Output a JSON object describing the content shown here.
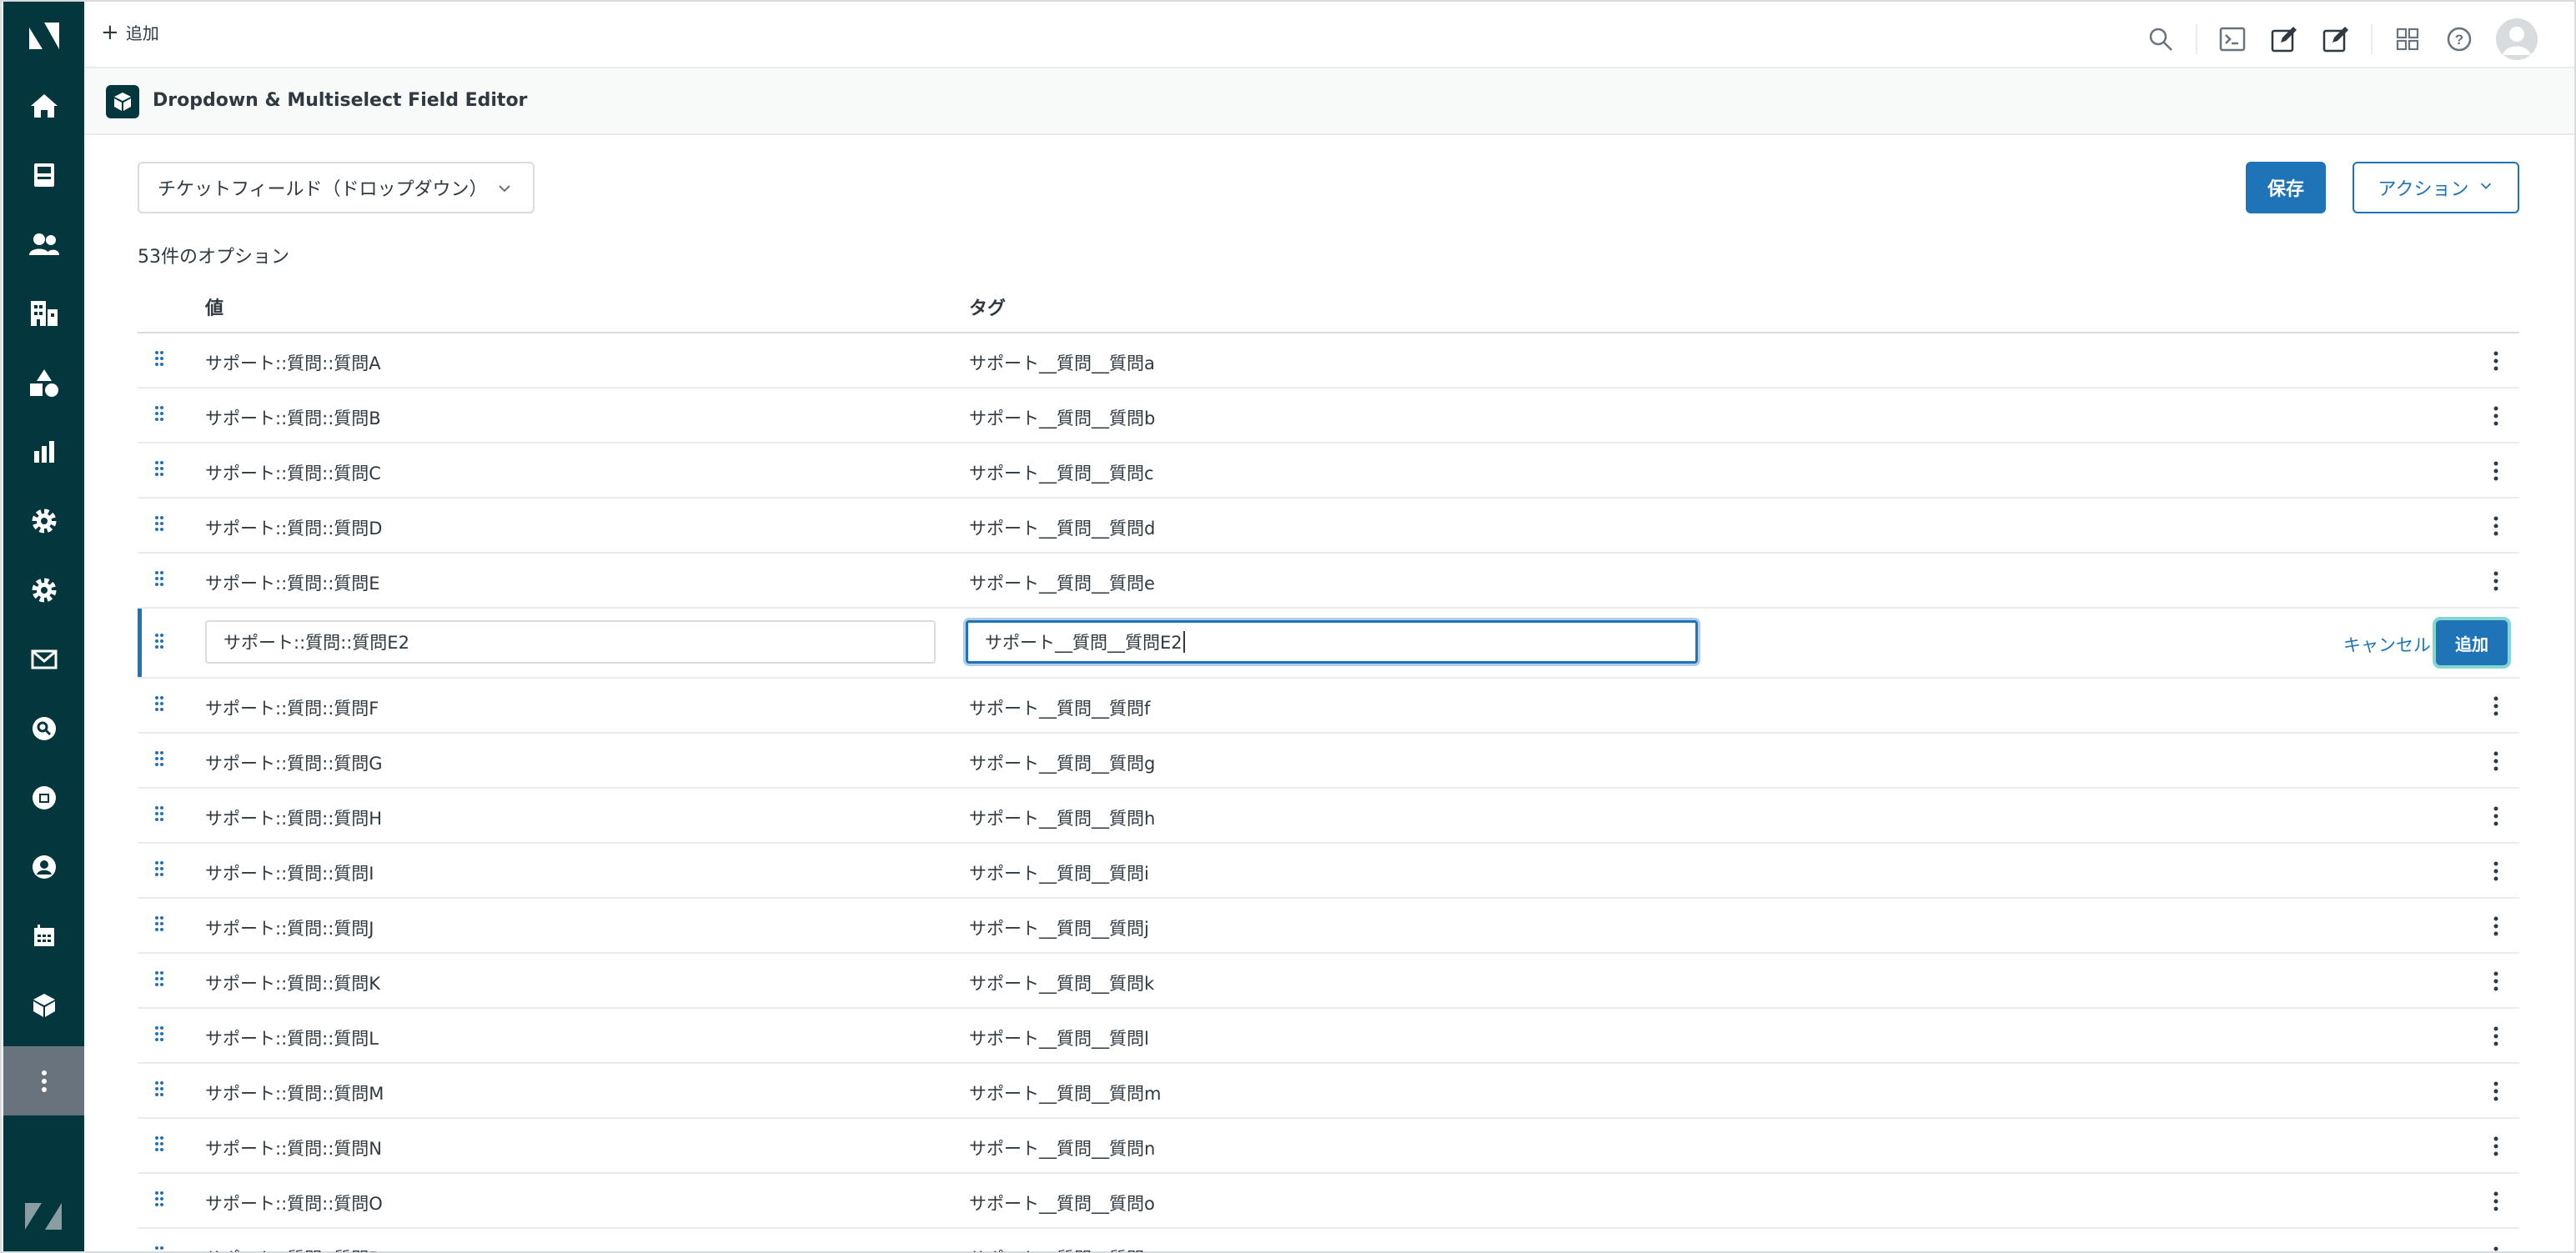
{
  "topbar": {
    "add_label": "追加",
    "icons": [
      "search-icon",
      "console-icon",
      "edit-icon",
      "compose-icon",
      "apps-grid-icon",
      "help-icon",
      "avatar"
    ]
  },
  "nav": {
    "items": [
      "home-icon",
      "views-icon",
      "customers-icon",
      "organizations-icon",
      "objects-icon",
      "reporting-icon",
      "admin-settings-icon",
      "settings-icon",
      "mail-icon",
      "search-app-icon",
      "shopify-app-icon",
      "profile-app-icon",
      "calendar-app-icon",
      "box-app-icon",
      "more-icon"
    ],
    "active_item": "more-icon"
  },
  "app": {
    "title": "Dropdown & Multiselect Field Editor"
  },
  "controls": {
    "field_selector": "チケットフィールド（ドロップダウン）",
    "save_label": "保存",
    "action_label": "アクション",
    "option_count": "53件のオプション"
  },
  "table": {
    "headers": {
      "value": "値",
      "tag": "タグ"
    },
    "rows_before": [
      {
        "value": "サポート::質問::質問A",
        "tag": "サポート__質問__質問a"
      },
      {
        "value": "サポート::質問::質問B",
        "tag": "サポート__質問__質問b"
      },
      {
        "value": "サポート::質問::質問C",
        "tag": "サポート__質問__質問c"
      },
      {
        "value": "サポート::質問::質問D",
        "tag": "サポート__質問__質問d"
      },
      {
        "value": "サポート::質問::質問E",
        "tag": "サポート__質問__質問e"
      }
    ],
    "edit_row": {
      "value": "サポート::質問::質問E2",
      "tag": "サポート__質問__質問E2",
      "cancel_label": "キャンセル",
      "add_label": "追加"
    },
    "rows_after": [
      {
        "value": "サポート::質問::質問F",
        "tag": "サポート__質問__質問f"
      },
      {
        "value": "サポート::質問::質問G",
        "tag": "サポート__質問__質問g"
      },
      {
        "value": "サポート::質問::質問H",
        "tag": "サポート__質問__質問h"
      },
      {
        "value": "サポート::質問::質問I",
        "tag": "サポート__質問__質問i"
      },
      {
        "value": "サポート::質問::質問J",
        "tag": "サポート__質問__質問j"
      },
      {
        "value": "サポート::質問::質問K",
        "tag": "サポート__質問__質問k"
      },
      {
        "value": "サポート::質問::質問L",
        "tag": "サポート__質問__質問l"
      },
      {
        "value": "サポート::質問::質問M",
        "tag": "サポート__質問__質問m"
      },
      {
        "value": "サポート::質問::質問N",
        "tag": "サポート__質問__質問n"
      },
      {
        "value": "サポート::質問::質問O",
        "tag": "サポート__質問__質問o"
      },
      {
        "value": "サポート::質問::質問P",
        "tag": "サポート__質問__質問p"
      }
    ]
  },
  "colors": {
    "nav_bg": "#03363d",
    "nav_active": "#68737d",
    "primary": "#1f73b7",
    "text": "#2f3941",
    "border": "#d8dcde"
  }
}
